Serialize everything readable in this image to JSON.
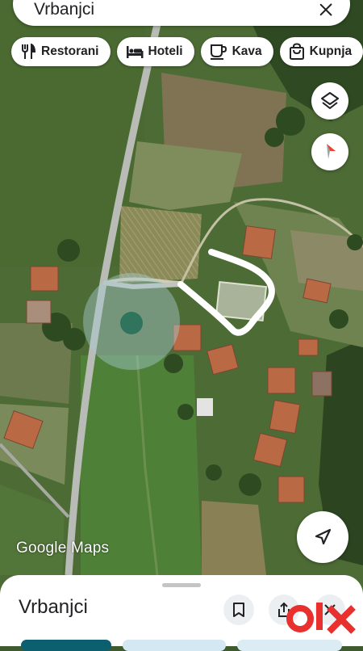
{
  "search": {
    "query": "Vrbanjci"
  },
  "chips": [
    {
      "label": "Restorani",
      "icon": "fork-knife-icon"
    },
    {
      "label": "Hoteli",
      "icon": "bed-icon"
    },
    {
      "label": "Kava",
      "icon": "coffee-cup-icon"
    },
    {
      "label": "Kupnja",
      "icon": "shopping-bag-icon"
    }
  ],
  "map": {
    "attribution": "Google Maps",
    "view": "satellite"
  },
  "place_sheet": {
    "title": "Vrbanjci"
  },
  "colors": {
    "brand_teal": "#0b5f6e",
    "compass_red": "#ea4335",
    "route_white": "#ffffff",
    "watermark_red": "#e8312f"
  }
}
